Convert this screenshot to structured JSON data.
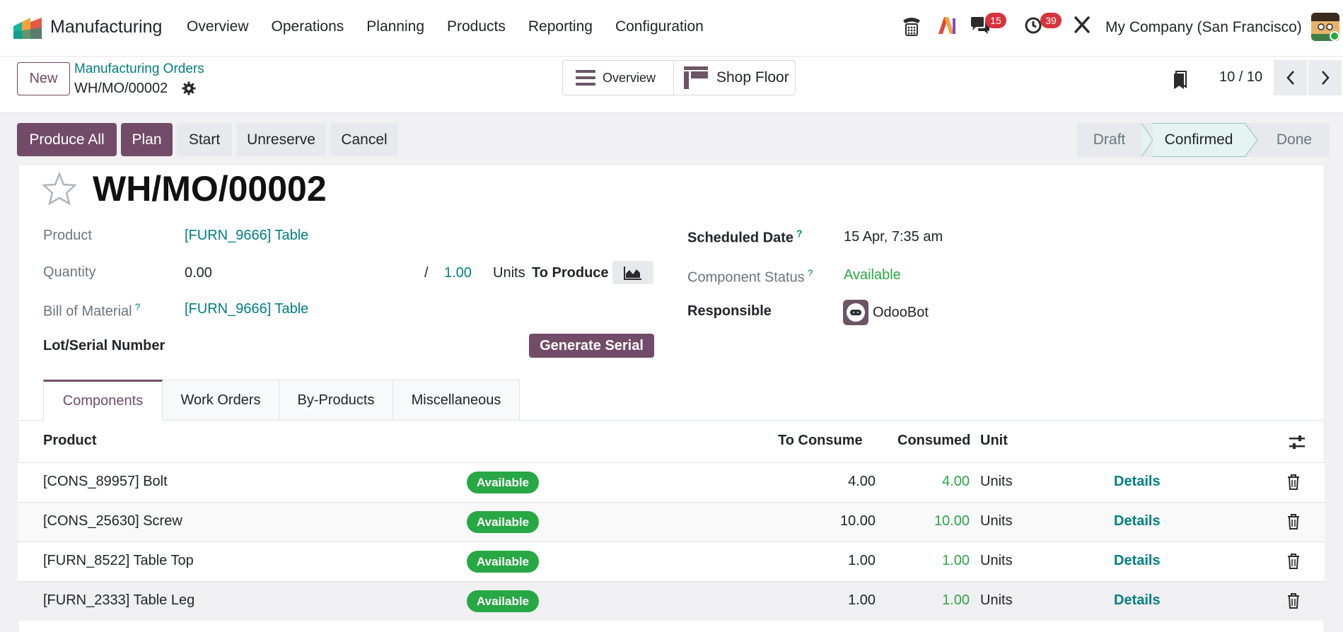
{
  "navbar": {
    "app_name": "Manufacturing",
    "menu": [
      "Overview",
      "Operations",
      "Planning",
      "Products",
      "Reporting",
      "Configuration"
    ],
    "messages_count": "15",
    "activities_count": "39",
    "company": "My Company (San Francisco)"
  },
  "control": {
    "new_label": "New",
    "breadcrumb_parent": "Manufacturing Orders",
    "breadcrumb_current": "WH/MO/00002",
    "overview_label": "Overview",
    "shop_floor_label": "Shop Floor",
    "pager": "10 / 10"
  },
  "actions": {
    "produce_all": "Produce All",
    "plan": "Plan",
    "start": "Start",
    "unreserve": "Unreserve",
    "cancel": "Cancel"
  },
  "status": {
    "stages": [
      "Draft",
      "Confirmed",
      "Done"
    ],
    "current": "Confirmed"
  },
  "form": {
    "title": "WH/MO/00002",
    "product_label": "Product",
    "product_value": "[FURN_9666] Table",
    "quantity_label": "Quantity",
    "quantity_value": "0.00",
    "quantity_sep": "/",
    "quantity_target": "1.00",
    "units_label": "Units",
    "to_produce": "To Produce",
    "bom_label": "Bill of Material",
    "bom_help": "?",
    "bom_value": "[FURN_9666] Table",
    "lot_label": "Lot/Serial Number",
    "generate_serial": "Generate Serial",
    "scheduled_label": "Scheduled Date",
    "scheduled_help": "?",
    "scheduled_value": "15 Apr, 7:35 am",
    "component_status_label": "Component Status",
    "component_status_help": "?",
    "component_status_value": "Available",
    "responsible_label": "Responsible",
    "responsible_value": "OdooBot"
  },
  "tabs": [
    "Components",
    "Work Orders",
    "By-Products",
    "Miscellaneous"
  ],
  "table": {
    "headers": {
      "product": "Product",
      "to_consume": "To Consume",
      "consumed": "Consumed",
      "unit": "Unit"
    },
    "rows": [
      {
        "product": "[CONS_89957] Bolt",
        "status": "Available",
        "to_consume": "4.00",
        "consumed": "4.00",
        "unit": "Units",
        "details": "Details"
      },
      {
        "product": "[CONS_25630] Screw",
        "status": "Available",
        "to_consume": "10.00",
        "consumed": "10.00",
        "unit": "Units",
        "details": "Details"
      },
      {
        "product": "[FURN_8522] Table Top",
        "status": "Available",
        "to_consume": "1.00",
        "consumed": "1.00",
        "unit": "Units",
        "details": "Details"
      },
      {
        "product": "[FURN_2333] Table Leg",
        "status": "Available",
        "to_consume": "1.00",
        "consumed": "1.00",
        "unit": "Units",
        "details": "Details"
      }
    ]
  },
  "colors": {
    "primary": "#714b67",
    "link": "#017e84",
    "success": "#28a745",
    "badge": "#d9323a"
  }
}
